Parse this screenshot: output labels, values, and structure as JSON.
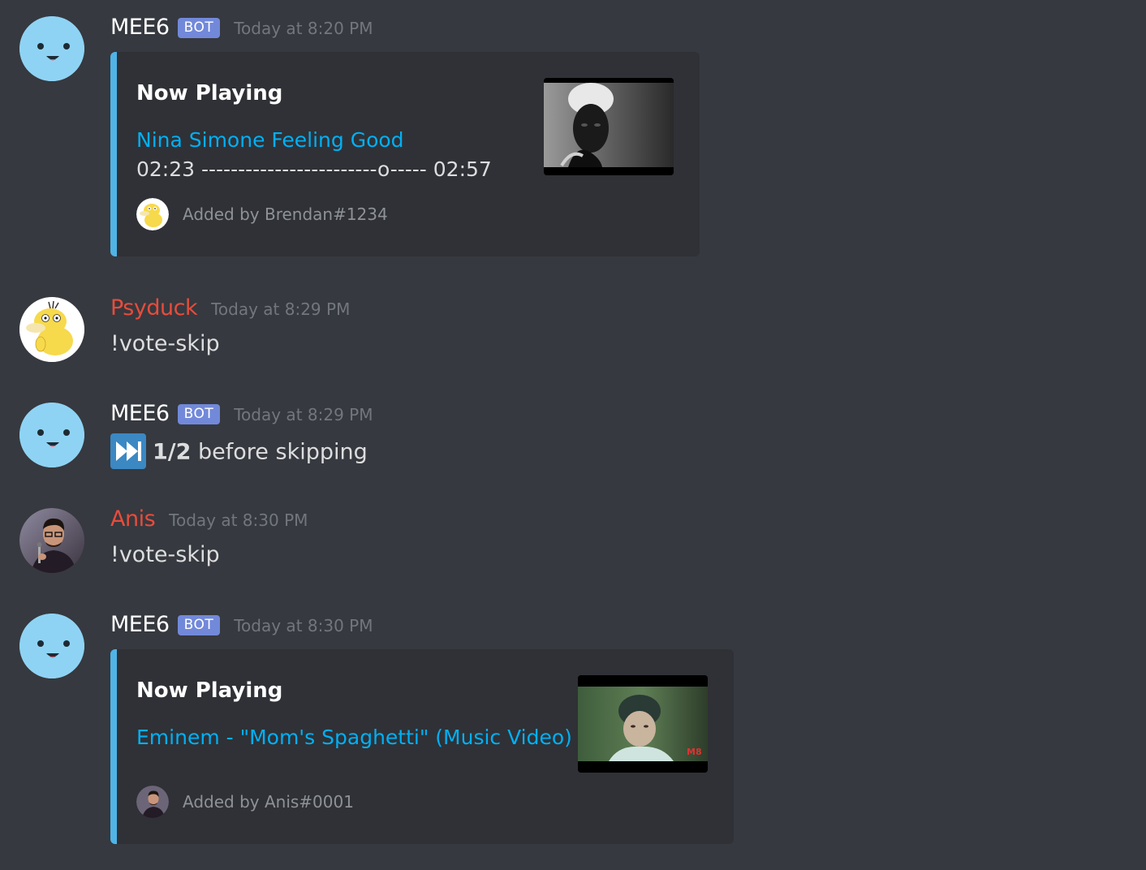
{
  "messages": [
    {
      "author": "MEE6",
      "bot_tag": "BOT",
      "timestamp": "Today at 8:20 PM",
      "embed": {
        "title": "Now Playing",
        "link": "Nina Simone Feeling Good",
        "progress": "02:23 ------------------------o----- 02:57",
        "footer": "Added by Brendan#1234"
      }
    },
    {
      "author": "Psyduck",
      "timestamp": "Today at 8:29 PM",
      "content": "!vote-skip"
    },
    {
      "author": "MEE6",
      "bot_tag": "BOT",
      "timestamp": "Today at 8:29 PM",
      "content_bold": "1/2",
      "content_rest": " before skipping"
    },
    {
      "author": "Anis",
      "timestamp": "Today at 8:30 PM",
      "content": "!vote-skip"
    },
    {
      "author": "MEE6",
      "bot_tag": "BOT",
      "timestamp": "Today at 8:30 PM",
      "embed": {
        "title": "Now Playing",
        "link": "Eminem - \"Mom's Spaghetti\" (Music Video)",
        "footer": "Added by Anis#0001"
      }
    }
  ],
  "colors": {
    "background": "#36393f",
    "embed_background": "#2f3136",
    "embed_accent": "#4fb4e6",
    "link": "#00b0f4",
    "bot_tag": "#7289da",
    "username_red": "#e74c3c",
    "timestamp": "#72767d"
  },
  "icons": [
    "mee6-avatar-icon",
    "psyduck-avatar-icon",
    "anis-avatar-icon",
    "track-next-icon"
  ]
}
